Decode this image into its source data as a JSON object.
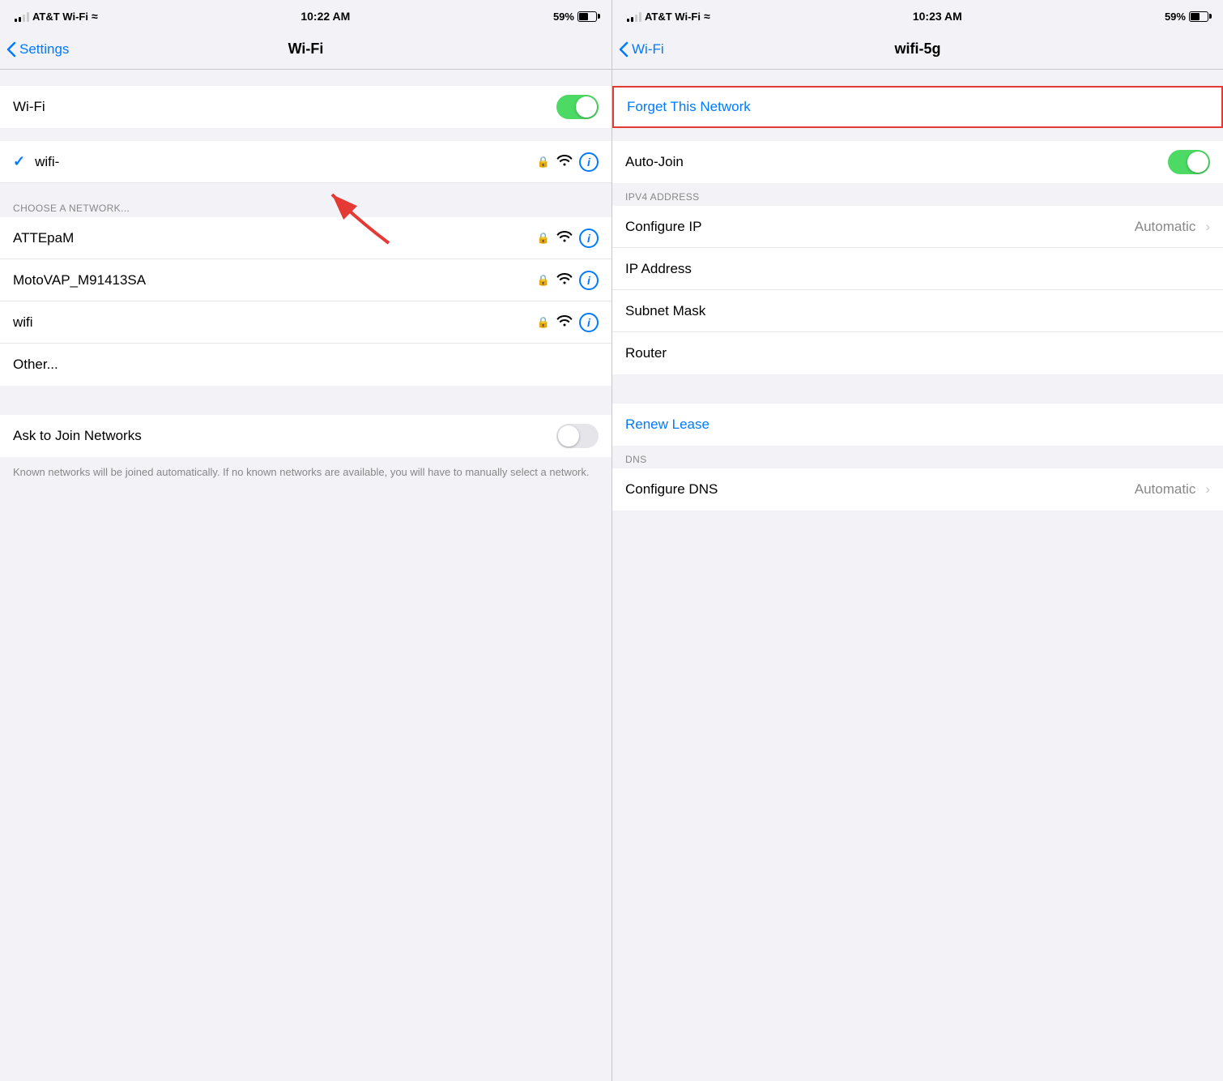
{
  "left_screen": {
    "status_bar": {
      "carrier": "AT&T Wi-Fi",
      "time": "10:22 AM",
      "battery": "59%"
    },
    "nav": {
      "back_label": "Settings",
      "title": "Wi-Fi"
    },
    "wifi_toggle": {
      "label": "Wi-Fi",
      "state": "on"
    },
    "connected_network": {
      "name": "wifi-",
      "checked": true
    },
    "section_label": "CHOOSE A NETWORK...",
    "networks": [
      {
        "name": "ATTEpaM"
      },
      {
        "name": "MotoVAP_M91413SA"
      },
      {
        "name": "wifi"
      },
      {
        "name": "Other..."
      }
    ],
    "ask_join": {
      "label": "Ask to Join Networks",
      "state": "off"
    },
    "footer_note": "Known networks will be joined automatically. If no known networks are available, you will have to manually select a network."
  },
  "right_screen": {
    "status_bar": {
      "carrier": "AT&T Wi-Fi",
      "time": "10:23 AM",
      "battery": "59%"
    },
    "nav": {
      "back_label": "Wi-Fi",
      "title": "wifi-5g"
    },
    "forget_network": "Forget This Network",
    "auto_join": {
      "label": "Auto-Join",
      "state": "on"
    },
    "ipv4_section": "IPV4 ADDRESS",
    "rows": [
      {
        "label": "Configure IP",
        "value": "Automatic",
        "chevron": true
      },
      {
        "label": "IP Address",
        "value": ""
      },
      {
        "label": "Subnet Mask",
        "value": ""
      },
      {
        "label": "Router",
        "value": ""
      }
    ],
    "renew_lease": "Renew Lease",
    "dns_section": "DNS",
    "dns_rows": [
      {
        "label": "Configure DNS",
        "value": "Automatic",
        "chevron": true
      }
    ]
  },
  "icons": {
    "back_chevron": "‹",
    "checkmark": "✓",
    "lock": "🔒",
    "wifi": "≋",
    "info": "i",
    "chevron_right": "›"
  }
}
